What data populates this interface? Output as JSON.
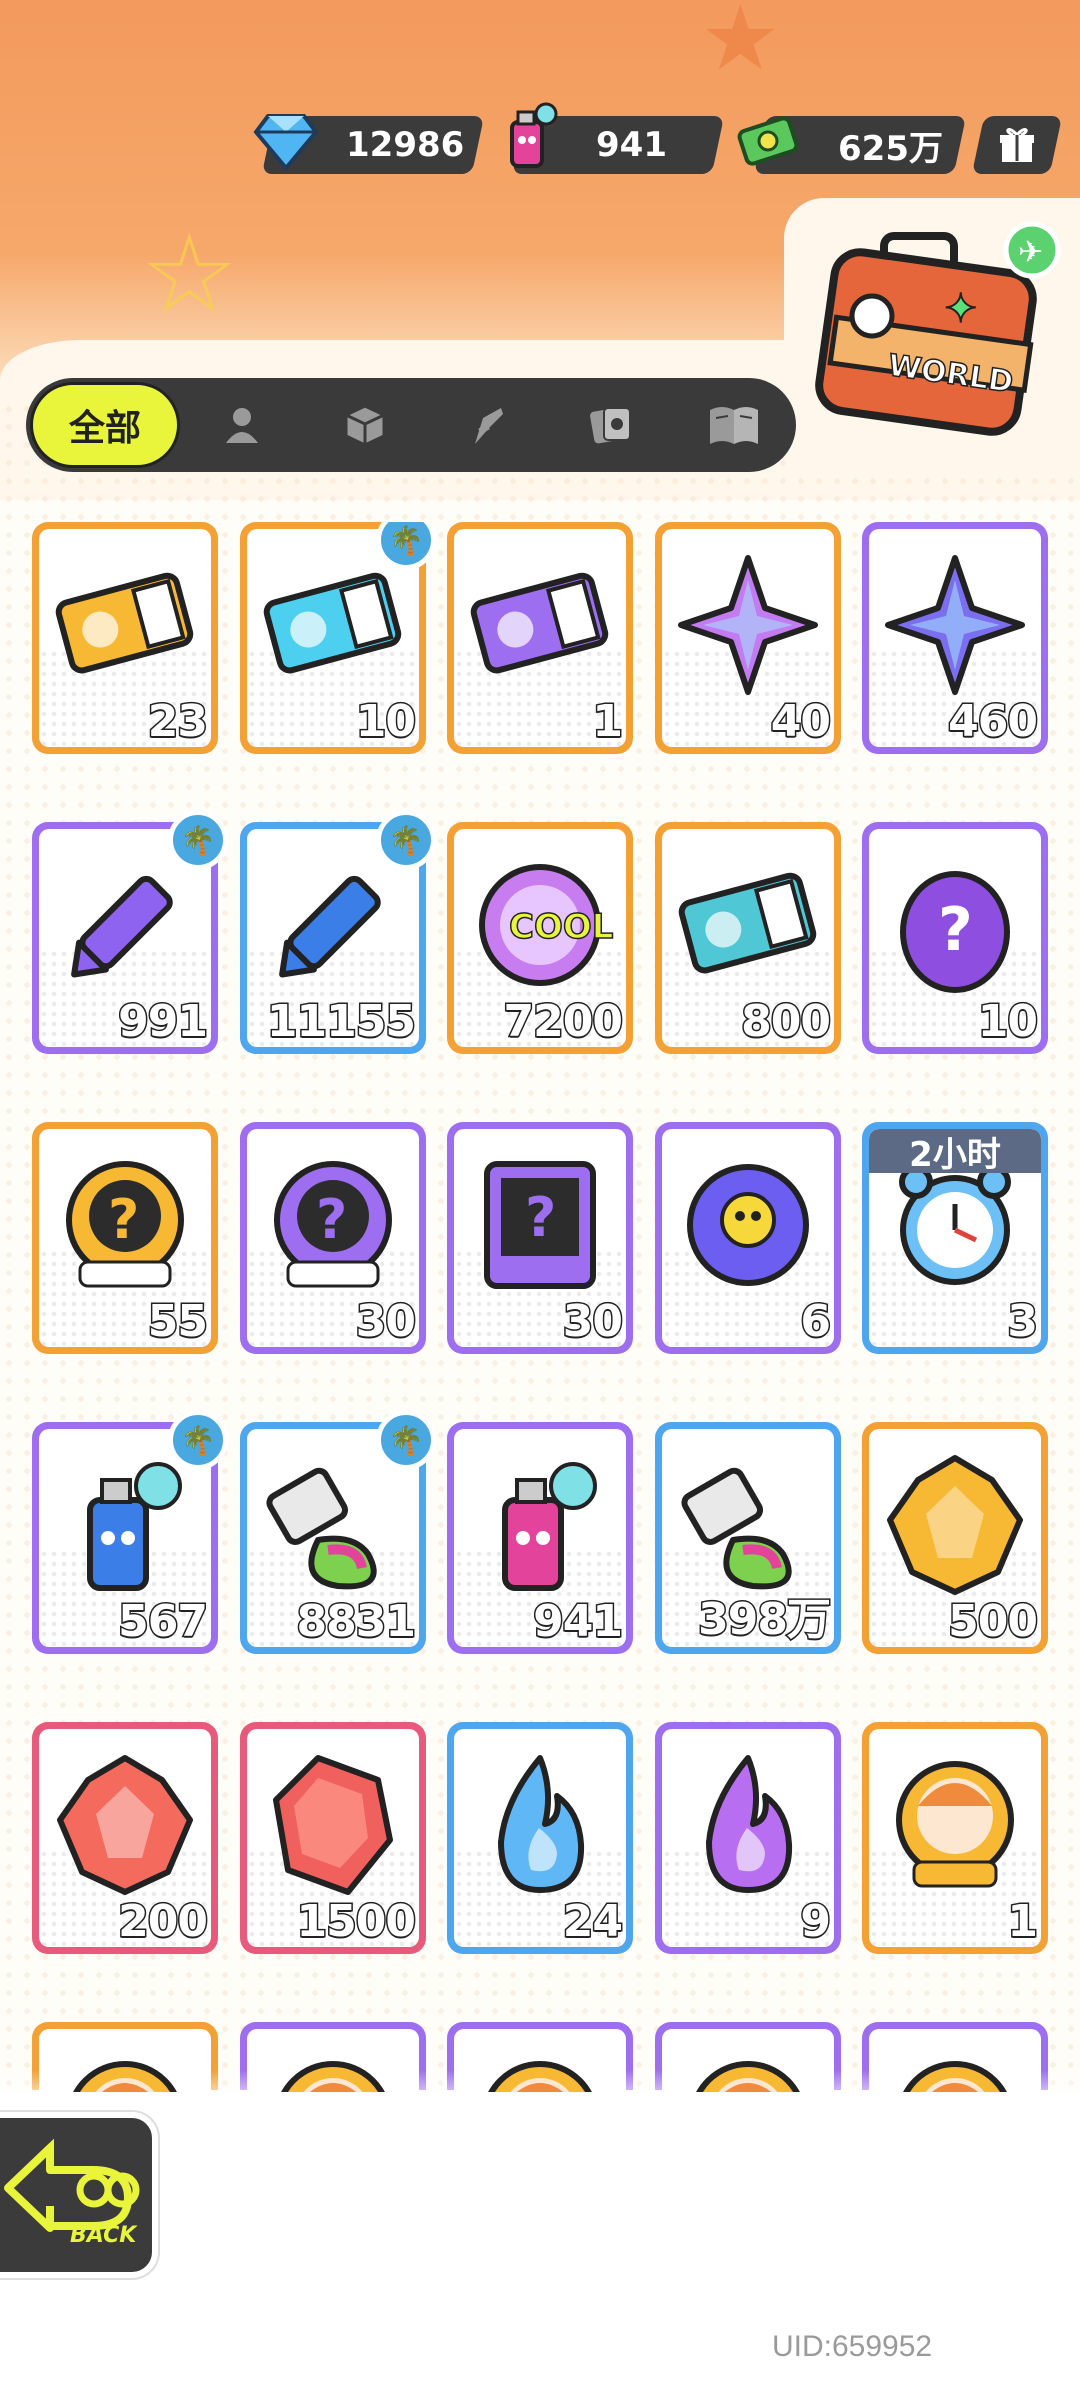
{
  "currency": {
    "gems": "12986",
    "spray": "941",
    "cash": "625万"
  },
  "tabs": {
    "active_label": "全部",
    "icons": [
      "person-icon",
      "box-icon",
      "brush-icon",
      "cards-icon",
      "book-icon"
    ]
  },
  "items": [
    {
      "count": "23",
      "border": "#f3a134",
      "icon": "gold-ticket-icon",
      "badge": false
    },
    {
      "count": "10",
      "border": "#f3a134",
      "icon": "up-ticket-icon",
      "badge": true
    },
    {
      "count": "1",
      "border": "#f3a134",
      "icon": "purple-ticket-icon",
      "badge": false
    },
    {
      "count": "40",
      "border": "#f3a134",
      "icon": "rainbow-star-icon",
      "badge": false
    },
    {
      "count": "460",
      "border": "#9e6ef0",
      "icon": "blue-star-icon",
      "badge": false
    },
    {
      "count": "991",
      "border": "#9e6ef0",
      "icon": "purple-crayon-icon",
      "badge": true
    },
    {
      "count": "11155",
      "border": "#4ea6ef",
      "icon": "blue-crayon-icon",
      "badge": true
    },
    {
      "count": "7200",
      "border": "#f3a134",
      "icon": "cool-coin-icon",
      "badge": false
    },
    {
      "count": "800",
      "border": "#f3a134",
      "icon": "season-ticket-icon",
      "badge": false
    },
    {
      "count": "10",
      "border": "#9e6ef0",
      "icon": "mystery-egg-icon",
      "badge": false
    },
    {
      "count": "55",
      "border": "#f3a134",
      "icon": "gold-mystery-badge-icon",
      "badge": false
    },
    {
      "count": "30",
      "border": "#9e6ef0",
      "icon": "purple-mystery-badge-icon",
      "badge": false
    },
    {
      "count": "30",
      "border": "#9e6ef0",
      "icon": "travel-card-icon",
      "badge": false
    },
    {
      "count": "6",
      "border": "#9e6ef0",
      "icon": "pet-orb-icon",
      "badge": false
    },
    {
      "count": "3",
      "border": "#4ea6ef",
      "icon": "alarm-clock-icon",
      "badge": false,
      "timer": "2小时"
    },
    {
      "count": "567",
      "border": "#9e6ef0",
      "icon": "blue-spray-can-icon",
      "badge": true
    },
    {
      "count": "8831",
      "border": "#4ea6ef",
      "icon": "paint-tube-icon",
      "badge": true
    },
    {
      "count": "941",
      "border": "#9e6ef0",
      "icon": "pink-spray-can-icon",
      "badge": false
    },
    {
      "count": "398万",
      "border": "#4ea6ef",
      "icon": "paint-tube-2-icon",
      "badge": false
    },
    {
      "count": "500",
      "border": "#f3a134",
      "icon": "gold-crystal-icon",
      "badge": false
    },
    {
      "count": "200",
      "border": "#e85a7c",
      "icon": "red-crystal-icon",
      "badge": false
    },
    {
      "count": "1500",
      "border": "#e85a7c",
      "icon": "red-gem-icon",
      "badge": false
    },
    {
      "count": "24",
      "border": "#4ea6ef",
      "icon": "blue-flame-icon",
      "badge": false
    },
    {
      "count": "9",
      "border": "#9e6ef0",
      "icon": "purple-flame-icon",
      "badge": false
    },
    {
      "count": "1",
      "border": "#f3a134",
      "icon": "avatar-badge-icon",
      "badge": false
    },
    {
      "count": "",
      "border": "#f3a134",
      "icon": "avatar-badge-icon",
      "badge": false
    },
    {
      "count": "",
      "border": "#9e6ef0",
      "icon": "avatar-badge-icon",
      "badge": false
    },
    {
      "count": "",
      "border": "#9e6ef0",
      "icon": "avatar-badge-icon",
      "badge": false
    },
    {
      "count": "",
      "border": "#9e6ef0",
      "icon": "avatar-badge-icon",
      "badge": false
    },
    {
      "count": "",
      "border": "#9e6ef0",
      "icon": "avatar-badge-icon",
      "badge": false
    }
  ],
  "back": {
    "label": "BACK"
  },
  "world": {
    "label": "WORLD"
  },
  "uid": "UID:659952"
}
